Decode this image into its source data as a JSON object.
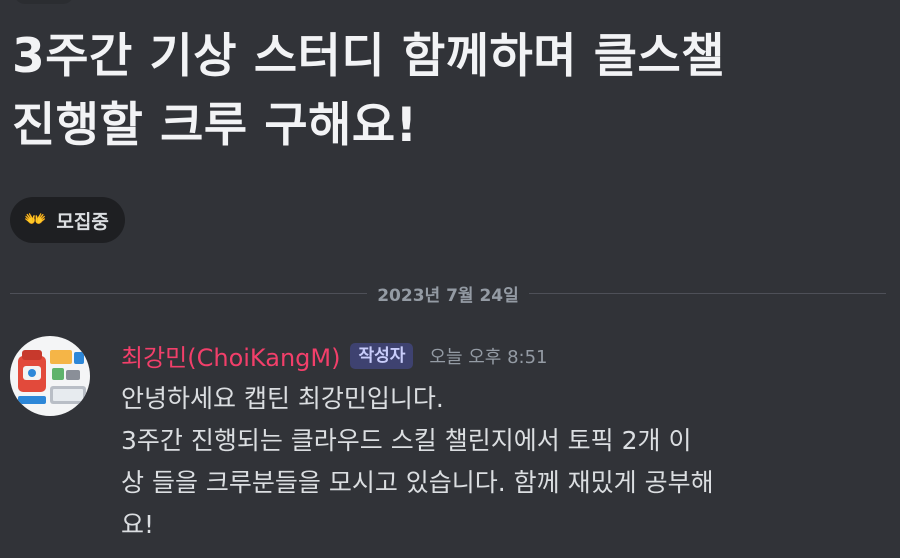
{
  "thread": {
    "title_line1": "3주간 기상 스터디 함께하며 클스챌",
    "title_line2": "진행할 크루 구해요!",
    "tag": {
      "emoji": "👐",
      "label": "모집중"
    }
  },
  "divider": {
    "date": "2023년 7월 24일"
  },
  "message": {
    "author": "최강민(ChoiKangM)",
    "badge": "작성자",
    "timestamp": "오늘 오후 8:51",
    "lines": [
      "안녕하세요 캡틴 최강민입니다.",
      "3주간 진행되는 클라우드 스킬 챌린지에서 토픽 2개 이",
      "상 들을 크루분들을 모시고 있습니다. 함께 재밌게 공부해",
      "요!"
    ]
  },
  "colors": {
    "background": "#313338",
    "author": "#f23f6a",
    "badge_bg": "#3e4270",
    "muted": "#949ba4"
  }
}
